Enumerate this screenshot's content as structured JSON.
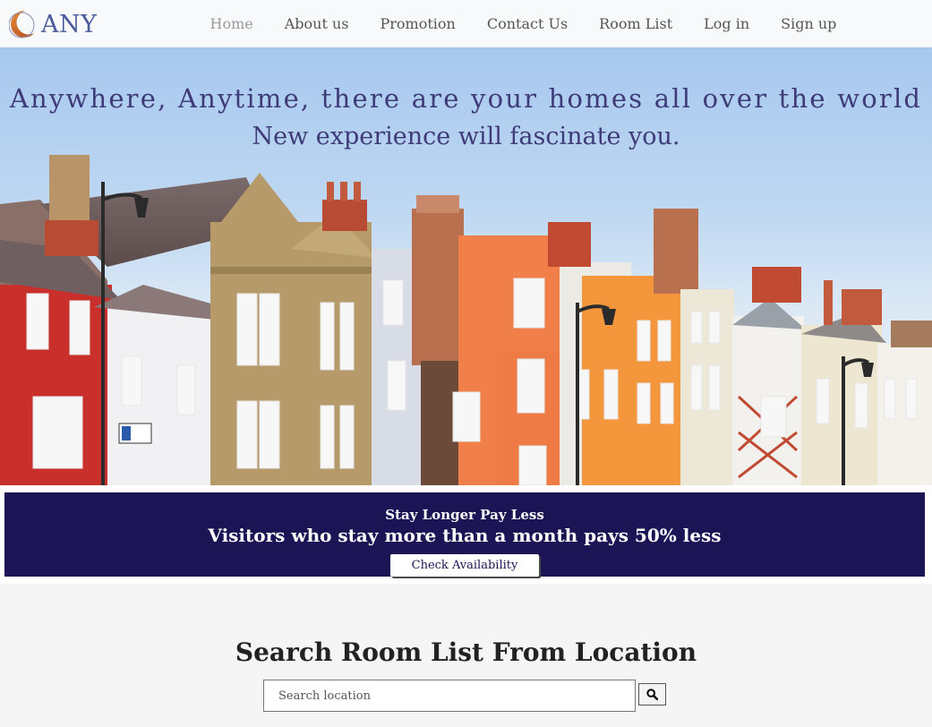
{
  "brand": {
    "name": "ANY"
  },
  "nav": {
    "items": [
      {
        "label": "Home",
        "active": true
      },
      {
        "label": "About us"
      },
      {
        "label": "Promotion"
      },
      {
        "label": "Contact Us"
      },
      {
        "label": "Room List"
      },
      {
        "label": "Log in"
      },
      {
        "label": "Sign up"
      }
    ]
  },
  "hero": {
    "title": "Anywhere, Anytime, there are your homes all over the world",
    "subtitle": "New experience will fascinate you."
  },
  "promo": {
    "heading": "Stay Longer Pay Less",
    "text": "Visitors who stay more than a month pays 50% less",
    "button_label": "Check Availability"
  },
  "search": {
    "title": "Search Room List From Location",
    "placeholder": "Search location",
    "value": "",
    "button_icon": "search-icon"
  },
  "colors": {
    "navbar_bg": "#f8f9fa",
    "nav_text": "#555555",
    "nav_active": "#9a9a9a",
    "brand": "#4a5a9c",
    "hero_text": "#3f3b78",
    "promo_bg": "#1b1556",
    "page_bg": "#f5f5f5"
  }
}
